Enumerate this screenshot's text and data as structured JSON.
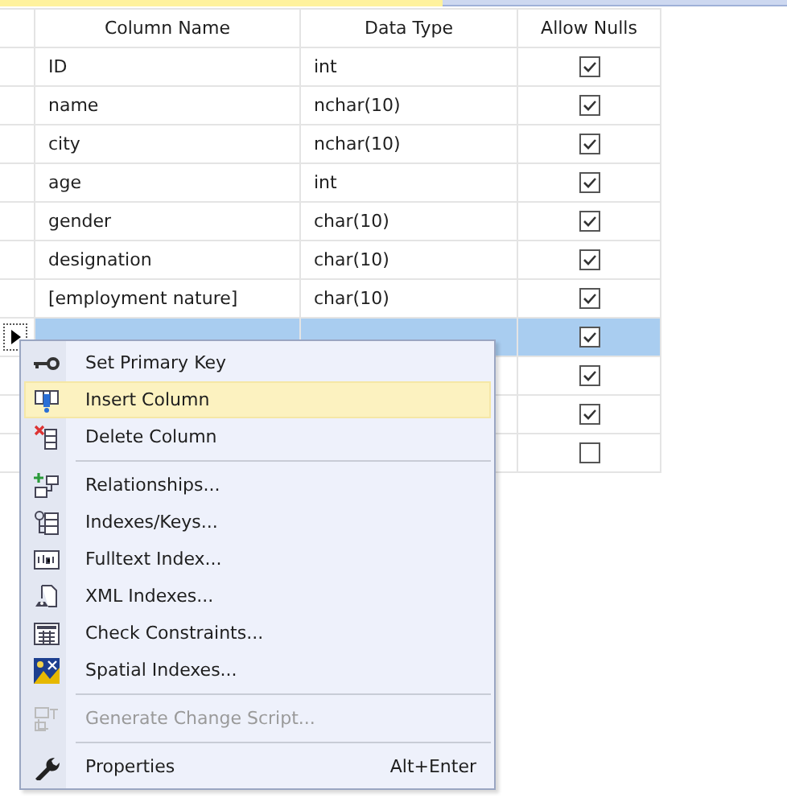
{
  "grid": {
    "columns": [
      "Column Name",
      "Data Type",
      "Allow Nulls"
    ],
    "rows": [
      {
        "name": "ID",
        "type": "int",
        "allow_nulls": true,
        "selected": false
      },
      {
        "name": "name",
        "type": "nchar(10)",
        "allow_nulls": true,
        "selected": false
      },
      {
        "name": "city",
        "type": "nchar(10)",
        "allow_nulls": true,
        "selected": false
      },
      {
        "name": "age",
        "type": "int",
        "allow_nulls": true,
        "selected": false
      },
      {
        "name": "gender",
        "type": "char(10)",
        "allow_nulls": true,
        "selected": false
      },
      {
        "name": "designation",
        "type": "char(10)",
        "allow_nulls": true,
        "selected": false
      },
      {
        "name": "[employment nature]",
        "type": "char(10)",
        "allow_nulls": true,
        "selected": false
      },
      {
        "allow_nulls": true,
        "selected": true
      },
      {
        "allow_nulls": true,
        "selected": false
      },
      {
        "allow_nulls": true,
        "selected": false
      },
      {
        "allow_nulls": false,
        "selected": false
      }
    ]
  },
  "context_menu": {
    "items": [
      {
        "kind": "item",
        "label": "Set Primary Key",
        "selected": false,
        "disabled": false
      },
      {
        "kind": "item",
        "label": "Insert Column",
        "selected": true,
        "disabled": false
      },
      {
        "kind": "item",
        "label": "Delete Column",
        "selected": false,
        "disabled": false
      },
      {
        "kind": "separator"
      },
      {
        "kind": "item",
        "label": "Relationships...",
        "selected": false,
        "disabled": false
      },
      {
        "kind": "item",
        "label": "Indexes/Keys...",
        "selected": false,
        "disabled": false
      },
      {
        "kind": "item",
        "label": "Fulltext Index...",
        "selected": false,
        "disabled": false
      },
      {
        "kind": "item",
        "label": "XML Indexes...",
        "selected": false,
        "disabled": false
      },
      {
        "kind": "item",
        "label": "Check Constraints...",
        "selected": false,
        "disabled": false
      },
      {
        "kind": "item",
        "label": "Spatial Indexes...",
        "selected": false,
        "disabled": false
      },
      {
        "kind": "separator"
      },
      {
        "kind": "item",
        "label": "Generate Change Script...",
        "selected": false,
        "disabled": true
      },
      {
        "kind": "separator"
      },
      {
        "kind": "item",
        "label": "Properties",
        "shortcut": "Alt+Enter",
        "selected": false,
        "disabled": false
      }
    ]
  }
}
